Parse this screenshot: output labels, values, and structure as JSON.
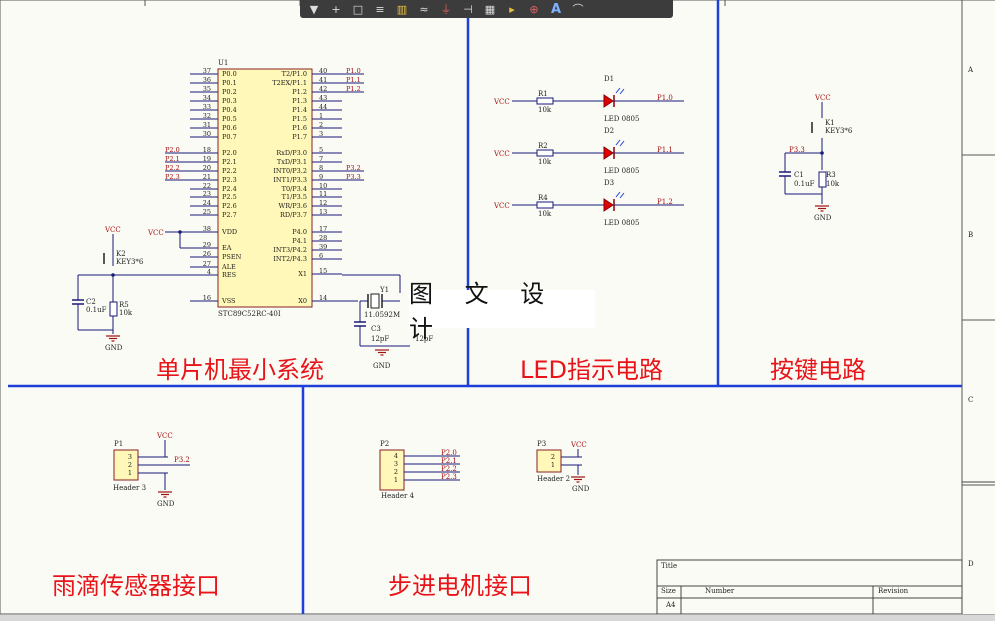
{
  "toolbar": {
    "items": [
      "filter-icon",
      "plus-icon",
      "select-rect-icon",
      "align-icon",
      "component-icon",
      "bus-icon",
      "ground-icon",
      "netlabel-icon",
      "part-icon",
      "diode-icon",
      "power-port-icon",
      "text-icon",
      "arc-icon"
    ]
  },
  "overlay_title": "图 文 设 计",
  "sections": {
    "mcu": "单片机最小系统",
    "led": "LED指示电路",
    "key": "按键电路",
    "rain": "雨滴传感器接口",
    "stepper": "步进电机接口"
  },
  "border_letters": [
    "A",
    "B",
    "C",
    "D"
  ],
  "mcu": {
    "designator": "U1",
    "part": "STC89C52RC-40I",
    "left_pins": [
      {
        "num": "37",
        "name": "P0.0"
      },
      {
        "num": "36",
        "name": "P0.1"
      },
      {
        "num": "35",
        "name": "P0.2"
      },
      {
        "num": "34",
        "name": "P0.3"
      },
      {
        "num": "33",
        "name": "P0.4"
      },
      {
        "num": "32",
        "name": "P0.5"
      },
      {
        "num": "31",
        "name": "P0.6"
      },
      {
        "num": "30",
        "name": "P0.7"
      },
      {
        "num": "18",
        "name": "P2.0"
      },
      {
        "num": "19",
        "name": "P2.1"
      },
      {
        "num": "20",
        "name": "P2.2"
      },
      {
        "num": "21",
        "name": "P2.3"
      },
      {
        "num": "22",
        "name": "P2.4"
      },
      {
        "num": "23",
        "name": "P2.5"
      },
      {
        "num": "24",
        "name": "P2.6"
      },
      {
        "num": "25",
        "name": "P2.7"
      },
      {
        "num": "38",
        "name": "VDD"
      },
      {
        "num": "29",
        "name": "EA"
      },
      {
        "num": "26",
        "name": "PSEN"
      },
      {
        "num": "27",
        "name": "ALE"
      },
      {
        "num": "4",
        "name": "RES"
      },
      {
        "num": "16",
        "name": "VSS"
      }
    ],
    "right_pins": [
      {
        "num": "40",
        "name": "T2/P1.0"
      },
      {
        "num": "41",
        "name": "T2EX/P1.1"
      },
      {
        "num": "42",
        "name": "P1.2"
      },
      {
        "num": "43",
        "name": "P1.3"
      },
      {
        "num": "44",
        "name": "P1.4"
      },
      {
        "num": "1",
        "name": "P1.5"
      },
      {
        "num": "2",
        "name": "P1.6"
      },
      {
        "num": "3",
        "name": "P1.7"
      },
      {
        "num": "5",
        "name": "RxD/P3.0"
      },
      {
        "num": "7",
        "name": "TxD/P3.1"
      },
      {
        "num": "8",
        "name": "INT0/P3.2"
      },
      {
        "num": "9",
        "name": "INT1/P3.3"
      },
      {
        "num": "10",
        "name": "T0/P3.4"
      },
      {
        "num": "11",
        "name": "T1/P3.5"
      },
      {
        "num": "12",
        "name": "WR/P3.6"
      },
      {
        "num": "13",
        "name": "RD/P3.7"
      },
      {
        "num": "17",
        "name": "P4.0"
      },
      {
        "num": "28",
        "name": "P4.1"
      },
      {
        "num": "39",
        "name": "INT3/P4.2"
      },
      {
        "num": "6",
        "name": "INT2/P4.3"
      },
      {
        "num": "15",
        "name": "X1"
      },
      {
        "num": "14",
        "name": "X0"
      }
    ],
    "net_left": [
      "P2.0",
      "P2.1",
      "P2.2",
      "P2.3"
    ],
    "net_right": [
      "P1.0",
      "P1.1",
      "P1.2",
      "P3.2",
      "P3.3"
    ]
  },
  "labels": {
    "vcc": "VCC",
    "gnd": "GND",
    "k2": "K2",
    "key": "KEY3*6",
    "c2": "C2",
    "c2v": "0.1uF",
    "r5": "R5",
    "r5v": "10k",
    "y1": "Y1",
    "y1v": "11.0592M",
    "c3": "C3",
    "c3v": "12pF",
    "c4v": "12pF",
    "r1": "R1",
    "r2": "R2",
    "r4": "R4",
    "rv": "10k",
    "d1": "D1",
    "d2": "D2",
    "d3": "D3",
    "led": "LED 0805",
    "p10": "P1.0",
    "p11": "P1.1",
    "p12": "P1.2",
    "k1": "K1",
    "c1": "C1",
    "c1v": "0.1uF",
    "r3": "R3",
    "r3v": "10k",
    "p33": "P3.3",
    "p1": "P1",
    "h3": "Header 3",
    "p32": "P3.2",
    "p2": "P2",
    "h4": "Header 4",
    "p2nets": [
      "P2.0",
      "P2.1",
      "P2.2",
      "P2.3"
    ],
    "p3": "P3",
    "h2": "Header 2"
  },
  "title_block": {
    "title": "Title",
    "size": "Size",
    "size_val": "A4",
    "number": "Number",
    "revision": "Revision"
  }
}
